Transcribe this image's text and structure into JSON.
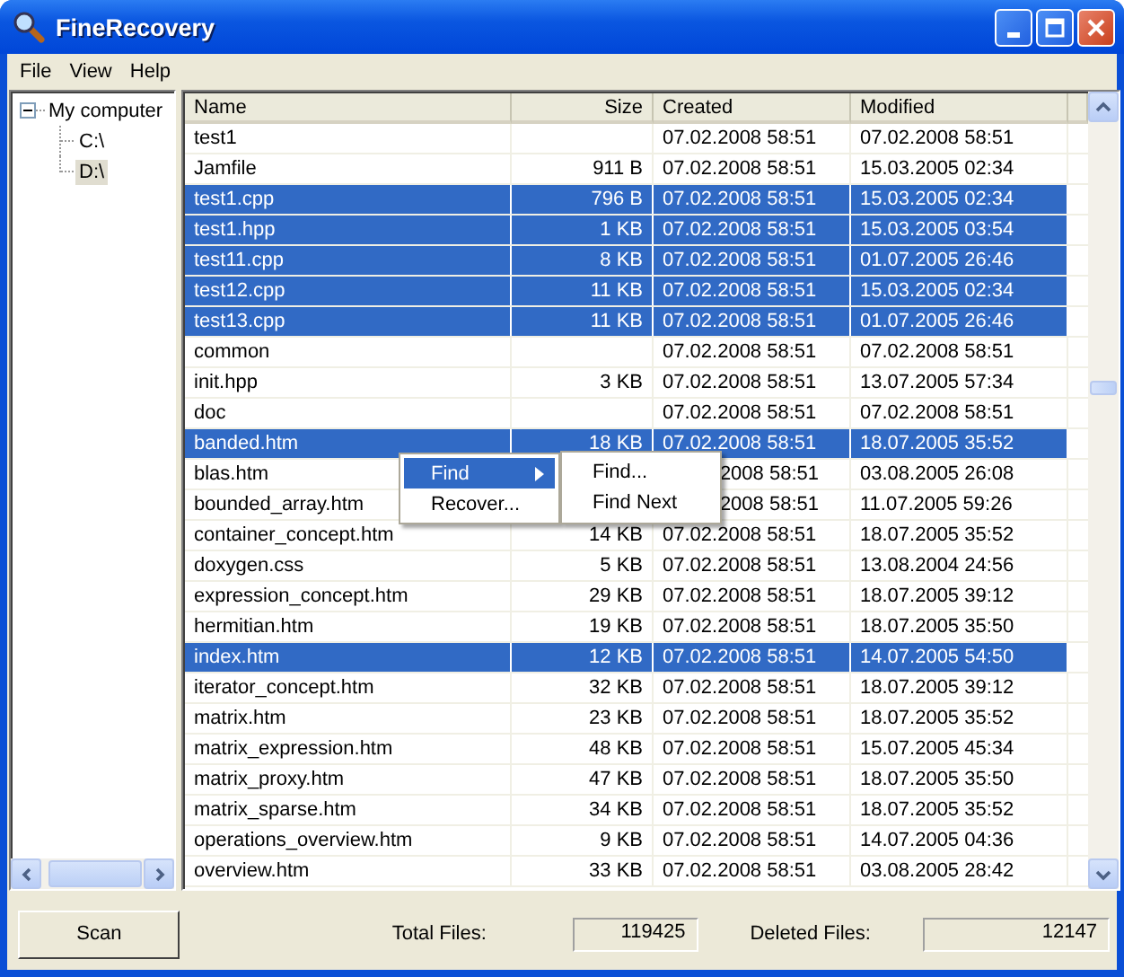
{
  "window": {
    "title": "FineRecovery"
  },
  "menu": [
    "File",
    "View",
    "Help"
  ],
  "tree": {
    "items": [
      {
        "label": "My computer",
        "expanded": true,
        "selected": false,
        "children": [
          {
            "label": "C:\\",
            "selected": false
          },
          {
            "label": "D:\\",
            "selected": true
          }
        ]
      }
    ]
  },
  "table": {
    "columns": [
      "Name",
      "Size",
      "Created",
      "Modified"
    ],
    "rows": [
      {
        "name": "test1",
        "created": "07.02.2008 58:51",
        "modified": "07.02.2008 58:51",
        "selected": false
      },
      {
        "name": "Jamfile",
        "size": "911 B",
        "created": "07.02.2008 58:51",
        "modified": "15.03.2005 02:34",
        "selected": false
      },
      {
        "name": "test1.cpp",
        "size": "796 B",
        "created": "07.02.2008 58:51",
        "modified": "15.03.2005 02:34",
        "selected": true
      },
      {
        "name": "test1.hpp",
        "size": "1 KB",
        "created": "07.02.2008 58:51",
        "modified": "15.03.2005 03:54",
        "selected": true
      },
      {
        "name": "test11.cpp",
        "size": "8 KB",
        "created": "07.02.2008 58:51",
        "modified": "01.07.2005 26:46",
        "selected": true
      },
      {
        "name": "test12.cpp",
        "size": "11 KB",
        "created": "07.02.2008 58:51",
        "modified": "15.03.2005 02:34",
        "selected": true
      },
      {
        "name": "test13.cpp",
        "size": "11 KB",
        "created": "07.02.2008 58:51",
        "modified": "01.07.2005 26:46",
        "selected": true
      },
      {
        "name": "common",
        "created": "07.02.2008 58:51",
        "modified": "07.02.2008 58:51",
        "selected": false
      },
      {
        "name": "init.hpp",
        "size": "3 KB",
        "created": "07.02.2008 58:51",
        "modified": "13.07.2005 57:34",
        "selected": false
      },
      {
        "name": "doc",
        "created": "07.02.2008 58:51",
        "modified": "07.02.2008 58:51",
        "selected": false
      },
      {
        "name": "banded.htm",
        "size": "18 KB",
        "created": "07.02.2008 58:51",
        "modified": "18.07.2005 35:52",
        "selected": true
      },
      {
        "name": "blas.htm",
        "created": "2008 58:51",
        "created_covered": true,
        "modified": "03.08.2005 26:08",
        "selected": false
      },
      {
        "name": "bounded_array.htm",
        "created": "2008 58:51",
        "created_covered": true,
        "modified": "11.07.2005 59:26",
        "selected": false
      },
      {
        "name": "container_concept.htm",
        "size": "14 KB",
        "created": "07.02.2008 58:51",
        "modified": "18.07.2005 35:52",
        "selected": false
      },
      {
        "name": "doxygen.css",
        "size": "5 KB",
        "created": "07.02.2008 58:51",
        "modified": "13.08.2004 24:56",
        "selected": false
      },
      {
        "name": "expression_concept.htm",
        "size": "29 KB",
        "created": "07.02.2008 58:51",
        "modified": "18.07.2005 39:12",
        "selected": false
      },
      {
        "name": "hermitian.htm",
        "size": "19 KB",
        "created": "07.02.2008 58:51",
        "modified": "18.07.2005 35:50",
        "selected": false
      },
      {
        "name": "index.htm",
        "size": "12 KB",
        "created": "07.02.2008 58:51",
        "modified": "14.07.2005 54:50",
        "selected": true
      },
      {
        "name": "iterator_concept.htm",
        "size": "32 KB",
        "created": "07.02.2008 58:51",
        "modified": "18.07.2005 39:12",
        "selected": false
      },
      {
        "name": "matrix.htm",
        "size": "23 KB",
        "created": "07.02.2008 58:51",
        "modified": "18.07.2005 35:52",
        "selected": false
      },
      {
        "name": "matrix_expression.htm",
        "size": "48 KB",
        "created": "07.02.2008 58:51",
        "modified": "15.07.2005 45:34",
        "selected": false
      },
      {
        "name": "matrix_proxy.htm",
        "size": "47 KB",
        "created": "07.02.2008 58:51",
        "modified": "18.07.2005 35:50",
        "selected": false
      },
      {
        "name": "matrix_sparse.htm",
        "size": "34 KB",
        "created": "07.02.2008 58:51",
        "modified": "18.07.2005 35:52",
        "selected": false
      },
      {
        "name": "operations_overview.htm",
        "size": "9 KB",
        "created": "07.02.2008 58:51",
        "modified": "14.07.2005 04:36",
        "selected": false
      },
      {
        "name": "overview.htm",
        "size": "33 KB",
        "created": "07.02.2008 58:51",
        "modified": "03.08.2005 28:42",
        "selected": false
      }
    ]
  },
  "context_menu": {
    "items": [
      {
        "label": "Find",
        "selected": true,
        "submenu": true
      },
      {
        "label": "Recover...",
        "selected": false,
        "submenu": false
      }
    ],
    "submenu": {
      "items": [
        "Find...",
        "Find Next"
      ]
    }
  },
  "status": {
    "scan_button": "Scan",
    "total_label": "Total Files:",
    "total_value": "119425",
    "deleted_label": "Deleted Files:",
    "deleted_value": "12147"
  }
}
